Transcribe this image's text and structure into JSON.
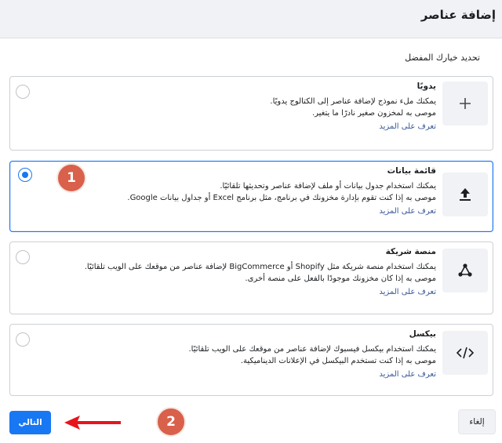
{
  "header": {
    "title": "إضافة عناصر"
  },
  "section": {
    "title": "تحديد خيارك المفضل"
  },
  "options": [
    {
      "title": "يدويًا",
      "desc1": "يمكنك ملء نموذج لإضافة عناصر إلى الكتالوج يدويًا.",
      "desc2": "موصى به لمخزون صغير نادرًا ما يتغير.",
      "link": "تعرف على المزيد",
      "icon": "plus-icon",
      "selected": false
    },
    {
      "title": "قائمة بيانات",
      "desc1": "يمكنك استخدام جدول بيانات أو ملف لإضافة عناصر وتحديثها تلقائيًا.",
      "desc2": "موصى به إذا كنت تقوم بإدارة مخزونك في برنامج، مثل برنامج Excel أو جداول بيانات Google.",
      "link": "تعرف على المزيد",
      "icon": "upload-icon",
      "selected": true
    },
    {
      "title": "منصة شريكة",
      "desc1": "يمكنك استخدام منصة شريكة مثل Shopify أو BigCommerce لإضافة عناصر من موقعك على الويب تلقائيًا.",
      "desc2": "موصى به إذا كان مخزونك موجودًا بالفعل على منصة أخرى.",
      "link": "تعرف على المزيد",
      "icon": "partner-network-icon",
      "selected": false
    },
    {
      "title": "بيكسل",
      "desc1": "يمكنك استخدام بيكسل فيسبوك لإضافة عناصر من موقعك على الويب تلقائيًا.",
      "desc2": "موصى به إذا كنت تستخدم البيكسل في الإعلانات الديناميكية.",
      "link": "تعرف على المزيد",
      "icon": "code-icon",
      "selected": false
    }
  ],
  "annotations": {
    "badge1": "1",
    "badge2": "2"
  },
  "footer": {
    "next_label": "التالي",
    "cancel_label": "إلغاء"
  },
  "colors": {
    "accent": "#1877f2",
    "badge": "#d9604a",
    "arrow": "#e8141c",
    "link": "#385898"
  }
}
